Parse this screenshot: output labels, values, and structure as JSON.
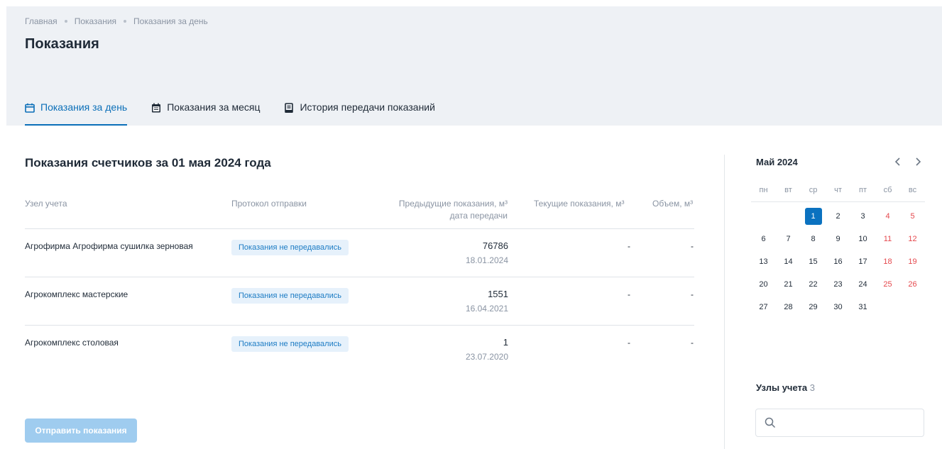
{
  "breadcrumb": [
    "Главная",
    "Показания",
    "Показания за день"
  ],
  "page_title": "Показания",
  "tabs": [
    {
      "label": "Показания за день",
      "icon": "calendar-icon",
      "active": true
    },
    {
      "label": "Показания за месяц",
      "icon": "calendar-list-icon",
      "active": false
    },
    {
      "label": "История передачи показаний",
      "icon": "document-icon",
      "active": false
    }
  ],
  "section_title": "Показания счетчиков за 01 мая 2024 года",
  "table": {
    "headers": {
      "node": "Узел учета",
      "protocol": "Протокол отправки",
      "prev_line1": "Предыдущие показания, м³",
      "prev_line2": "дата передачи",
      "current": "Текущие показания, м³",
      "volume": "Объем, м³"
    },
    "rows": [
      {
        "node": "Агрофирма Агрофирма сушилка зерновая",
        "protocol": "Показания не передавались",
        "prev_value": "76786",
        "prev_date": "18.01.2024",
        "current": "-",
        "volume": "-"
      },
      {
        "node": "Агрокомплекс мастерские",
        "protocol": "Показания не передавались",
        "prev_value": "1551",
        "prev_date": "16.04.2021",
        "current": "-",
        "volume": "-"
      },
      {
        "node": "Агрокомплекс столовая",
        "protocol": "Показания не передавались",
        "prev_value": "1",
        "prev_date": "23.07.2020",
        "current": "-",
        "volume": "-"
      }
    ]
  },
  "send_button": "Отправить показания",
  "calendar": {
    "title": "Май 2024",
    "weekdays": [
      "пн",
      "вт",
      "ср",
      "чт",
      "пт",
      "сб",
      "вс"
    ],
    "weeks": [
      [
        "",
        "",
        "1",
        "2",
        "3",
        "4",
        "5"
      ],
      [
        "6",
        "7",
        "8",
        "9",
        "10",
        "11",
        "12"
      ],
      [
        "13",
        "14",
        "15",
        "16",
        "17",
        "18",
        "19"
      ],
      [
        "20",
        "21",
        "22",
        "23",
        "24",
        "25",
        "26"
      ],
      [
        "27",
        "28",
        "29",
        "30",
        "31",
        "",
        ""
      ]
    ],
    "selected": "1"
  },
  "nodes": {
    "label": "Узлы учета",
    "count": "3"
  },
  "search": {
    "placeholder": ""
  },
  "colors": {
    "accent": "#0b6fb8",
    "header_bg": "#eef1f5",
    "weekend": "#e5484d",
    "badge_bg": "#e6f1fb"
  }
}
